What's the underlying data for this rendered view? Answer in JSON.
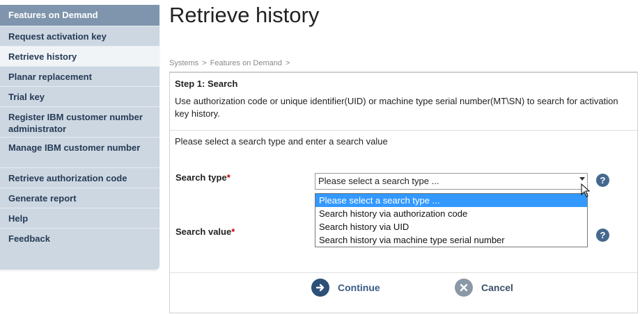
{
  "sidebar": {
    "header": "Features on Demand",
    "items": [
      {
        "label": "Request activation key"
      },
      {
        "label": "Retrieve history"
      },
      {
        "label": "Planar replacement"
      },
      {
        "label": "Trial key"
      },
      {
        "label": "Register IBM customer number administrator"
      },
      {
        "label": "Manage IBM customer number"
      },
      {
        "label": "Retrieve authorization code"
      },
      {
        "label": "Generate report"
      },
      {
        "label": "Help"
      },
      {
        "label": "Feedback"
      }
    ],
    "active_item": "Retrieve history"
  },
  "page": {
    "title": "Retrieve history",
    "breadcrumb": [
      "Systems",
      "Features on Demand"
    ],
    "breadcrumb_sep": ">"
  },
  "form": {
    "step_title": "Step 1: Search",
    "step_description": "Use authorization code or unique identifier(UID) or machine type serial number(MT\\SN) to search for activation key history.",
    "instruction": "Please select a search type and enter a search value",
    "search_type_label": "Search type",
    "search_value_label": "Search value",
    "required_mark": "*",
    "search_type_value": "Please select a search type ...",
    "search_type_options": [
      "Please select a search type ...",
      "Search history via authorization code",
      "Search history via UID",
      "Search history via machine type serial number"
    ],
    "help_glyph": "?"
  },
  "buttons": {
    "continue_label": "Continue",
    "cancel_label": "Cancel"
  },
  "icons": {
    "continue": "arrow-right-icon",
    "cancel": "close-icon",
    "help": "help-icon"
  },
  "colors": {
    "sidebar_header": "#7f95ad",
    "sidebar_bg": "#cdd7e2",
    "selected_option": "#3399ff",
    "help_icon": "#45698e",
    "required": "#c00000"
  }
}
